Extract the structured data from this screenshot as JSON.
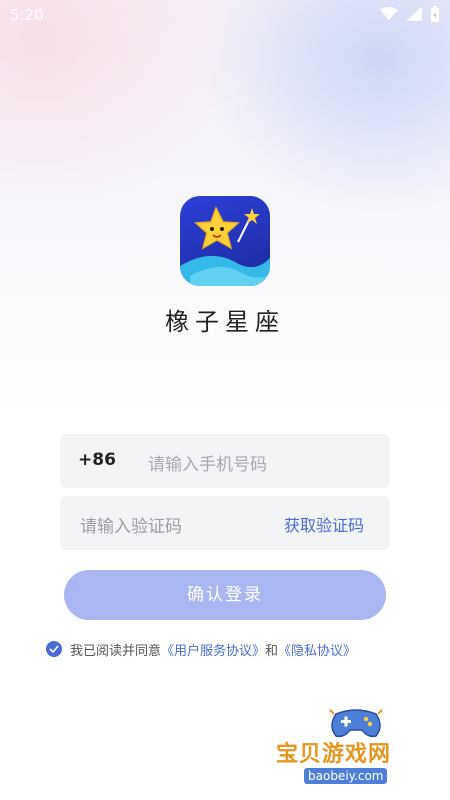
{
  "status_bar": {
    "time": "5:20"
  },
  "app": {
    "name": "橡子星座"
  },
  "phone": {
    "country_code": "+86",
    "placeholder": "请输入手机号码"
  },
  "code": {
    "placeholder": "请输入验证码",
    "get_code_label": "获取验证码"
  },
  "login": {
    "button_label": "确认登录"
  },
  "agreement": {
    "prefix": "我已阅读并同意",
    "user_agreement": "《用户服务协议》",
    "and": "和",
    "privacy_policy": "《隐私协议》",
    "checked": true
  },
  "watermark": {
    "title": "宝贝游戏网",
    "url": "baobeiy.com"
  },
  "colors": {
    "accent": "#4a6bd8",
    "button": "#a9b6f2",
    "icon_bg": "#2d3fd8"
  }
}
